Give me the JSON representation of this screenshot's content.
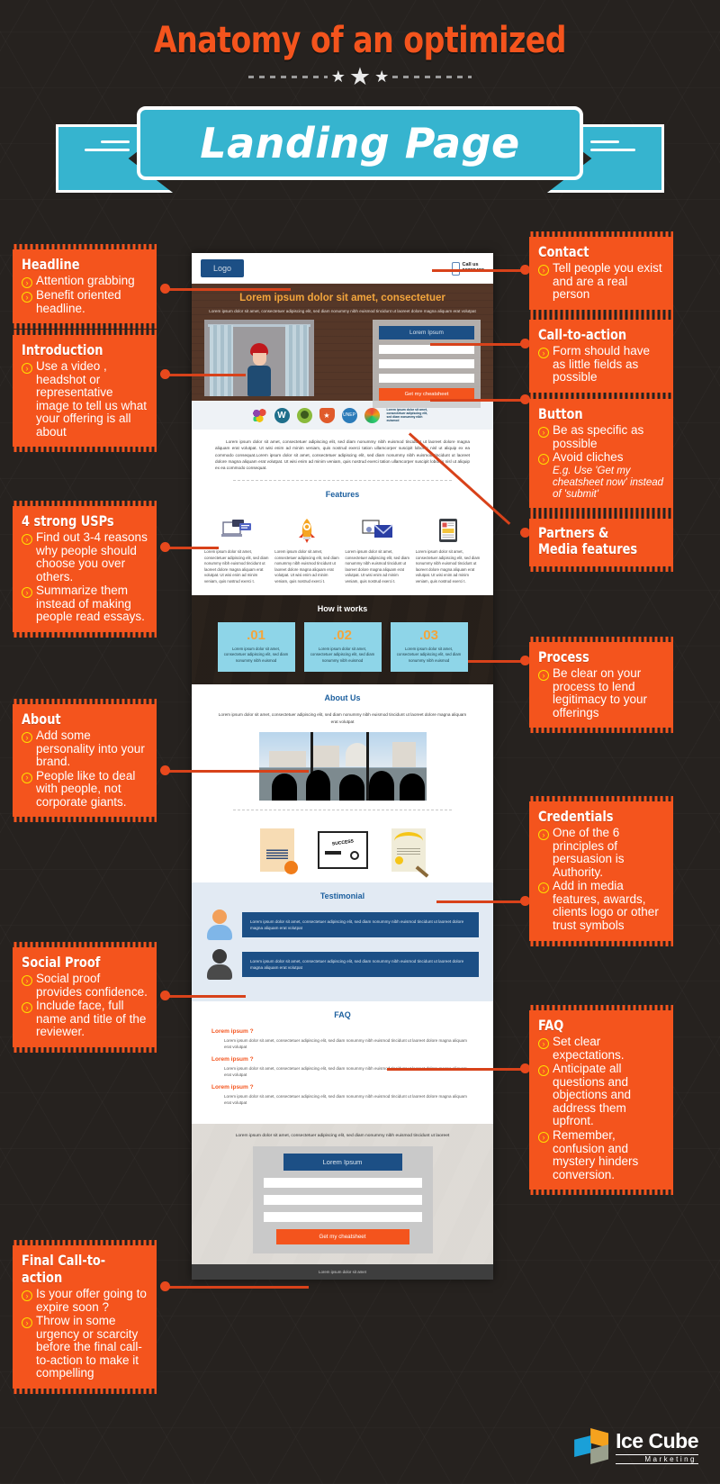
{
  "header": {
    "title": "Anatomy of an optimized",
    "ribbon": "Landing Page"
  },
  "callouts_left": [
    {
      "id": "headline",
      "title": "Headline",
      "items": [
        "Attention grabbing",
        "Benefit oriented headline."
      ]
    },
    {
      "id": "introduction",
      "title": "Introduction",
      "items": [
        "Use a video , headshot or representative image to tell us what your offering is all about"
      ]
    },
    {
      "id": "usps",
      "title": "4 strong USPs",
      "items": [
        "Find out 3-4 reasons why people should choose you over others.",
        "Summarize them instead of making people read essays."
      ]
    },
    {
      "id": "about",
      "title": "About",
      "items": [
        "Add some personality into your brand.",
        "People like to deal with people, not corporate giants."
      ]
    },
    {
      "id": "social-proof",
      "title": "Social Proof",
      "items": [
        "Social proof provides confidence.",
        "Include face, full name and title of the reviewer."
      ]
    },
    {
      "id": "final-cta",
      "title": "Final Call-to-action",
      "items": [
        "Is your offer going to expire soon ?",
        "Throw in some urgency or scarcity before the final call-to-action to make it compelling"
      ]
    }
  ],
  "callouts_right": [
    {
      "id": "contact",
      "title": "Contact",
      "items": [
        "Tell people you exist and are a real person"
      ]
    },
    {
      "id": "call-to-action",
      "title": "Call-to-action",
      "items": [
        "Form should have as little fields as possible"
      ]
    },
    {
      "id": "button",
      "title": "Button",
      "items": [
        "Be as specific as possible",
        "Avoid cliches"
      ],
      "note": "E.g. Use 'Get my cheatsheet now' instead of 'submit'"
    },
    {
      "id": "partners-media",
      "title": "Partners & Media features",
      "items": []
    },
    {
      "id": "process",
      "title": "Process",
      "items": [
        "Be clear on your process to lend legitimacy to your offerings"
      ]
    },
    {
      "id": "credentials",
      "title": "Credentials",
      "items": [
        "One   of the 6 principles of persuasion is Authority.",
        "Add in media features, awards, clients logo or other trust symbols"
      ]
    },
    {
      "id": "faq",
      "title": "FAQ",
      "items": [
        "Set clear expectations.",
        "Anticipate all questions and objections and address them upfront.",
        "Remember, confusion and mystery hinders conversion."
      ]
    }
  ],
  "mockup": {
    "nav": {
      "logo": "Logo",
      "call_label": "Call us",
      "call_number": "98765432"
    },
    "hero": {
      "headline": "Lorem ipsum dolor sit amet, consectetuer",
      "subtext": "Lorem ipsum dolor sit amet, consectetuer adipiscing elit, sed diam nonummy nibh euismod tincidunt ut laoreet dolore magna aliquam erat volutpat",
      "form_title": "Lorem Ipsum",
      "cta": "Get my cheatsheet"
    },
    "partners": {
      "unep_label": "UNEP",
      "caption": "Lorem ipsum dolor sit amet, consectetuer adipiscing elit, sed diam nonummy nibh euismod"
    },
    "intro_paragraph": "Lorem ipsum dolor sit amet, consectetuer adipiscing elit, sed diam nonummy nibh euismod tincidunt ut laoreet dolore magna aliquam erat volutpat. Ut wisi enim ad minim veniam, quis nostrud exerci tation ullamcorper suscipit lobortis nisl ut aliquip ex ea commodo consequat.Lorem ipsum dolor sit amet, consectetuer adipiscing elit, sed diam nonummy nibh euismod tincidunt ut laoreet dolore magna aliquam erat volutpat. Ut wisi enim ad minim veniam, quis nostrud exerci tation ullamcorper suscipit lobortis nisl ut aliquip ex ea commodo consequat.",
    "features": {
      "title": "Features",
      "items": [
        "Lorem ipsum dolor sit amet, consectetuer adipiscing elit, sed diam nonummy nibh euismod tincidunt ut laoreet dolore magna aliquam erat volutpat. Ut wisi enim ad minim veniam, quis nostrud exerci t.",
        "Lorem ipsum dolor sit amet, consectetuer adipiscing elit, sed diam nonummy nibh euismod tincidunt ut laoreet dolore magna aliquam erat volutpat. Ut wisi enim ad minim veniam, quis nostrud exerci t.",
        "Lorem ipsum dolor sit amet, consectetuer adipiscing elit, sed diam nonummy nibh euismod tincidunt ut laoreet dolore magna aliquam erat volutpat. Ut wisi enim ad minim veniam, quis nostrud exerci t.",
        "Lorem ipsum dolor sit amet, consectetuer adipiscing elit, sed diam nonummy nibh euismod tincidunt ut laoreet dolore magna aliquam erat volutpat. Ut wisi enim ad minim veniam, quis nostrud exerci t."
      ]
    },
    "how_it_works": {
      "title": "How it works",
      "steps": [
        {
          "number": ".01",
          "text": "Lorem ipsum dolor sit amet, consectetuer adipiscing elit, sed diam nonummy nibh euismod"
        },
        {
          "number": ".02",
          "text": "Lorem ipsum dolor sit amet, consectetuer adipiscing elit, sed diam nonummy nibh euismod"
        },
        {
          "number": ".03",
          "text": "Lorem ipsum dolor sit amet, consectetuer adipiscing elit, sed diam nonummy nibh euismod"
        }
      ]
    },
    "about": {
      "title": "About Us",
      "text": "Lorem ipsum dolor sit amet, consectetuer adipiscing elit, sed diam nonummy nibh euismod tincidunt ut laoreet dolore magna aliquam erat volutpat"
    },
    "certificates": {
      "success_label": "SUCCESS"
    },
    "testimonial": {
      "title": "Testimonial",
      "items": [
        "Lorem ipsum dolor sit amet, consectetuer adipiscing elit, sed diam nonummy nibh euismod tincidunt ut laoreet dolore magna aliquam erat volutpat",
        "Lorem ipsum dolor sit amet, consectetuer adipiscing elit, sed diam nonummy nibh euismod tincidunt ut laoreet dolore magna aliquam erat volutpat"
      ]
    },
    "faq": {
      "title": "FAQ",
      "items": [
        {
          "q": "Lorem ipsum ?",
          "a": "Lorem ipsum dolor sit amet, consectetuer adipiscing elit, sed diam nonummy nibh euismod tincidunt ut laoreet dolore magna aliquam erat volutpat"
        },
        {
          "q": "Lorem ipsum ?",
          "a": "Lorem ipsum dolor sit amet, consectetuer adipiscing elit, sed diam nonummy nibh euismod tincidunt ut laoreet dolore magna aliquam erat volutpat"
        },
        {
          "q": "Lorem ipsum ?",
          "a": "Lorem ipsum dolor sit amet, consectetuer adipiscing elit, sed diam nonummy nibh euismod tincidunt ut laoreet dolore magna aliquam erat volutpat"
        }
      ]
    },
    "final": {
      "subtext": "Lorem ipsum dolor sit amet, consectetuer adipiscing elit, sed diam nonummy nibh euismod tincidunt ut laoreet",
      "form_title": "Lorem Ipsum",
      "cta": "Get my cheatsheet"
    },
    "footer": "Lorem ipsum dolor sit amet"
  },
  "brand": {
    "name": "Ice Cube",
    "tagline": "Marketing"
  },
  "colors": {
    "orange": "#f4541d",
    "cyan": "#36b4cf",
    "dark_bg": "#26221f",
    "bullet_yellow": "#ffe000",
    "mock_blue": "#1c4f85"
  }
}
